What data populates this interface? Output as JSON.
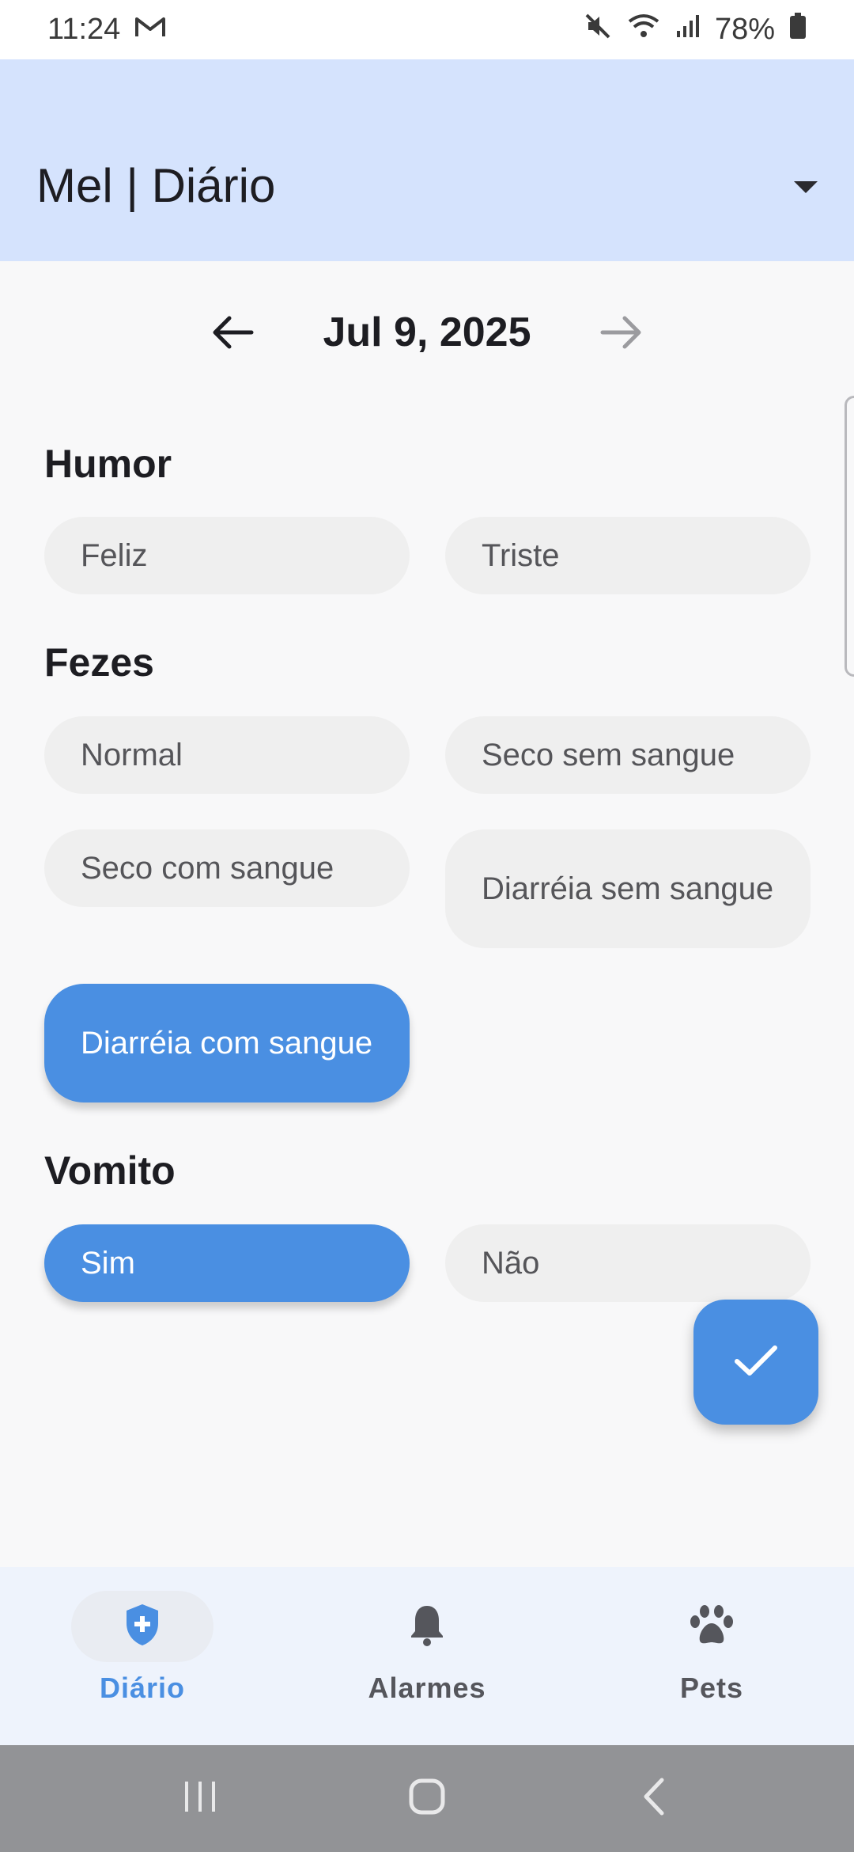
{
  "status_bar": {
    "time": "11:24",
    "battery": "78%"
  },
  "app_bar": {
    "title": "Mel | Diário"
  },
  "date_nav": {
    "date": "Jul 9, 2025"
  },
  "sections": {
    "humor": {
      "title": "Humor",
      "options": [
        "Feliz",
        "Triste"
      ]
    },
    "fezes": {
      "title": "Fezes",
      "options": [
        "Normal",
        "Seco sem sangue",
        "Seco com sangue",
        "Diarréia sem sangue",
        "Diarréia com sangue"
      ]
    },
    "vomito": {
      "title": "Vomito",
      "options": [
        "Sim",
        "Não"
      ]
    }
  },
  "bottom_nav": {
    "items": [
      {
        "label": "Diário",
        "icon": "shield-plus-icon",
        "active": true
      },
      {
        "label": "Alarmes",
        "icon": "bell-icon",
        "active": false
      },
      {
        "label": "Pets",
        "icon": "paw-icon",
        "active": false
      }
    ]
  },
  "colors": {
    "accent": "#4a8fe2",
    "app_bar_bg": "#d5e3fd",
    "chip_bg": "#efefef",
    "nav_bg": "#eef3fc"
  }
}
